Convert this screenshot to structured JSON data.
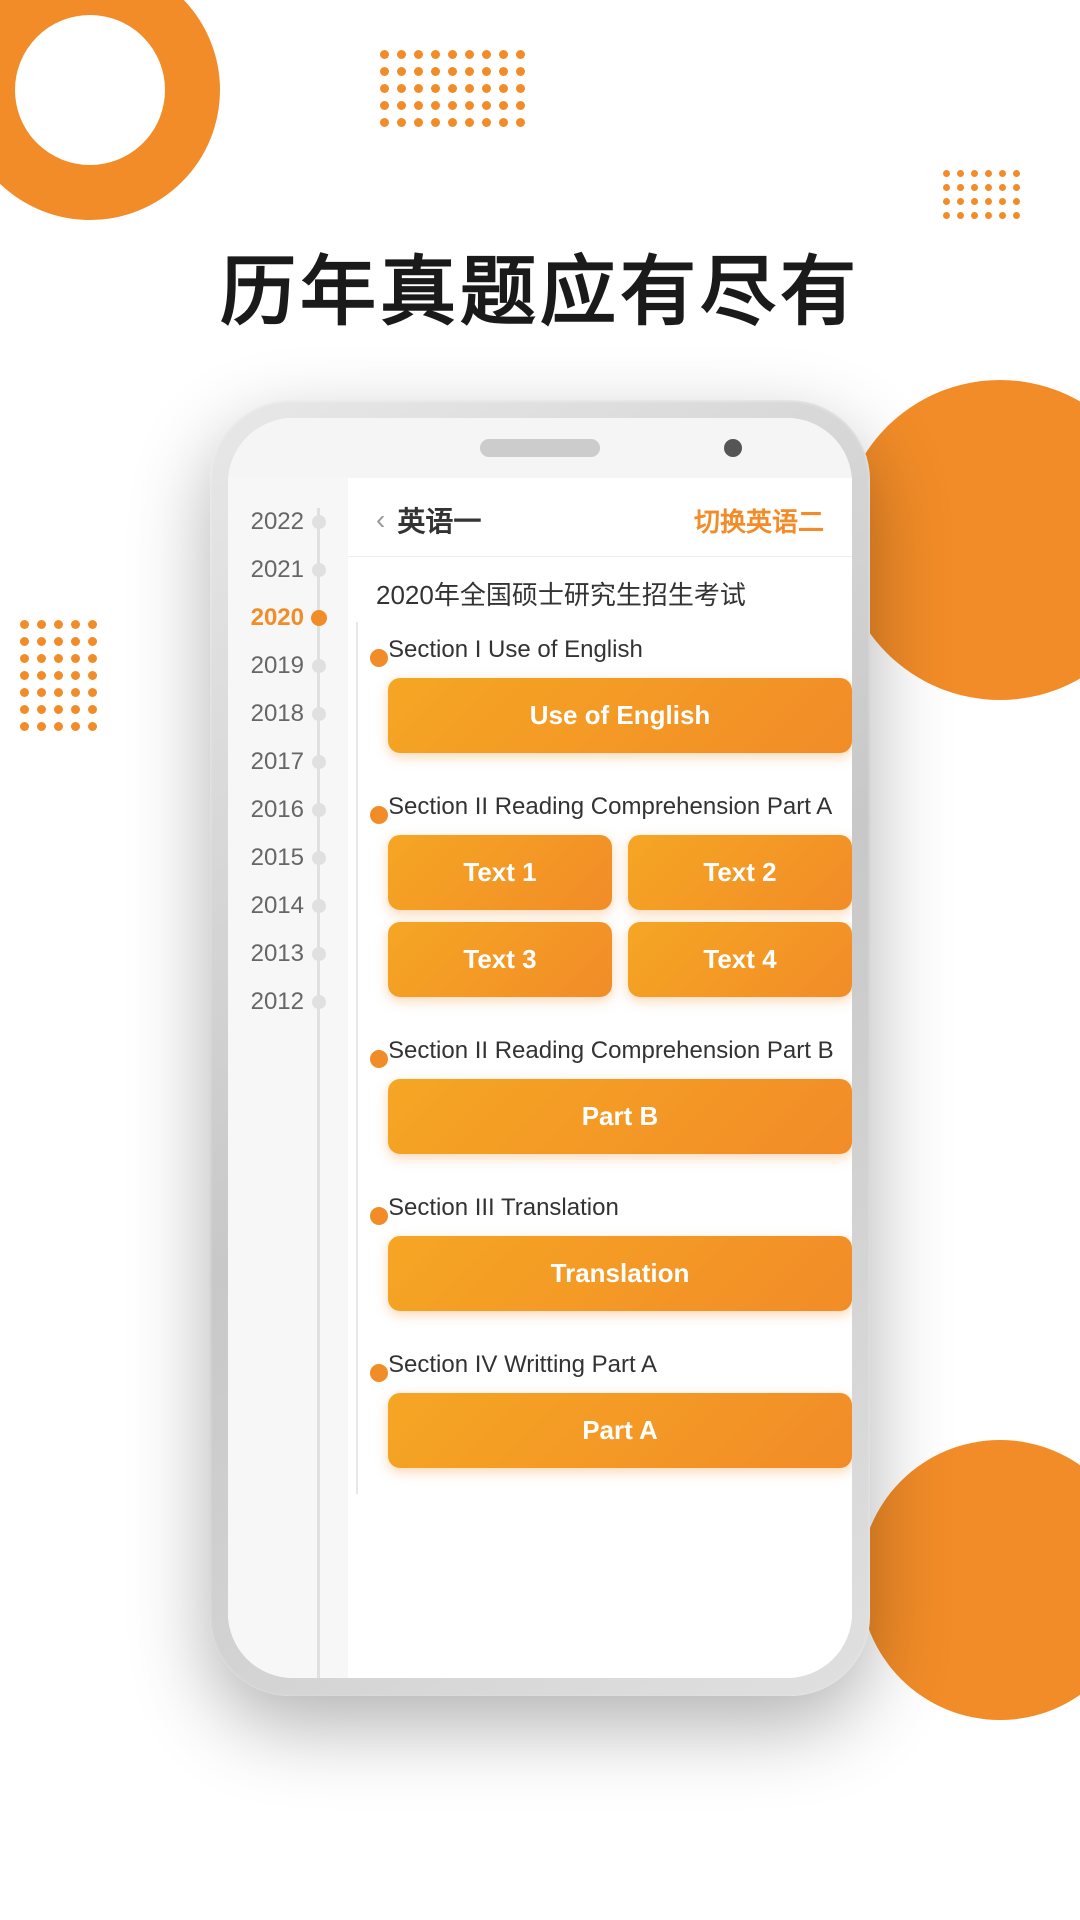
{
  "page": {
    "main_title": "历年真题应有尽有"
  },
  "phone": {
    "header": {
      "back_icon": "‹",
      "title_cn": "英语一",
      "switch_label": "切换英语二",
      "exam_title": "2020年全国硕士研究生招生考试"
    },
    "year_sidebar": {
      "years": [
        "2022",
        "2021",
        "2020",
        "2019",
        "2018",
        "2017",
        "2016",
        "2015",
        "2014",
        "2013",
        "2012"
      ],
      "active_year": "2020"
    },
    "sections": [
      {
        "id": "section-1",
        "label": "Section I Use of English",
        "buttons": [
          [
            "Use of English"
          ]
        ]
      },
      {
        "id": "section-2",
        "label": "Section II Reading Comprehension Part A",
        "buttons": [
          [
            "Text 1",
            "Text 2"
          ],
          [
            "Text 3",
            "Text 4"
          ]
        ]
      },
      {
        "id": "section-3",
        "label": "Section II Reading Comprehension Part B",
        "buttons": [
          [
            "Part B"
          ]
        ]
      },
      {
        "id": "section-4",
        "label": "Section III Translation",
        "buttons": [
          [
            "Translation"
          ]
        ]
      },
      {
        "id": "section-5",
        "label": "Section IV Writting Part A",
        "buttons": [
          [
            "Part A"
          ]
        ]
      }
    ]
  }
}
